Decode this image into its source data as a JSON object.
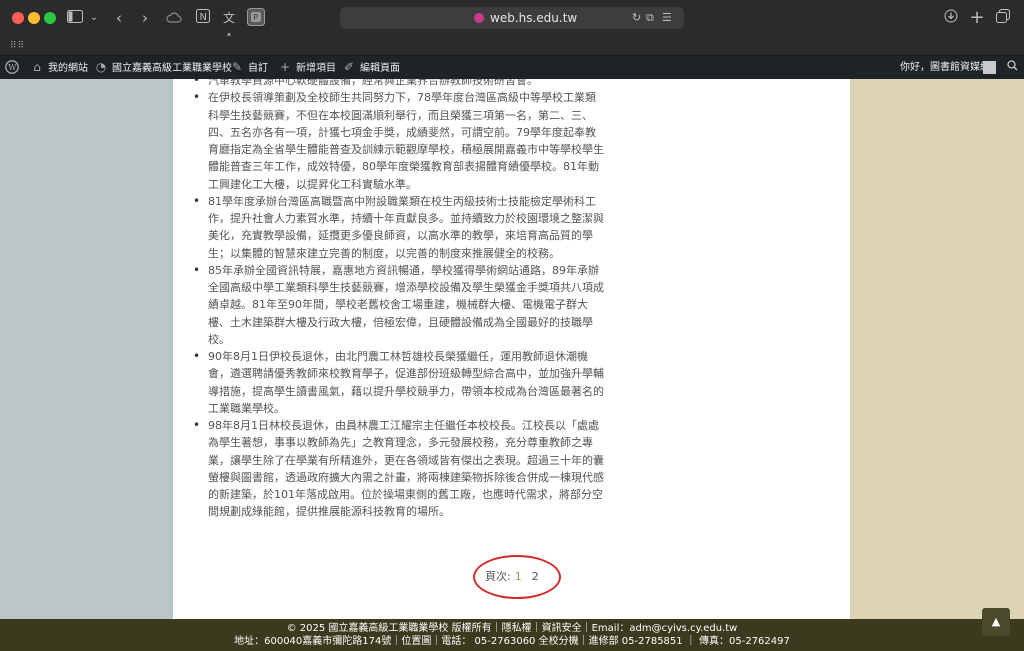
{
  "browser": {
    "url": "web.hs.edu.tw"
  },
  "adminbar": {
    "my_sites": "我的網站",
    "site_name": "國立嘉義高級工業職業學校",
    "customize": "自訂",
    "new_item": "新增項目",
    "edit_page": "編輯頁面",
    "greeting": "你好，圖書館資媒組"
  },
  "content": {
    "top_partial": "汽車教學資源中心軟硬體設備，經常與企業界合辦教師技術研習會。",
    "items": [
      "在伊校長領導策劃及全校師生共同努力下，78學年度台灣區高級中等學校工業類科學生技藝競賽，不但在本校圓滿順利舉行，而且榮獲三項第一名，第二、三、四、五名亦各有一項，計獲七項金手獎，成績斐然，可謂空前。79學年度起奉教育廳指定為全省學生體能普查及訓練示範觀摩學校，積極展開嘉義市中等學校學生體能普查三年工作，成效特優，80學年度榮獲教育部表揚體育績優學校。81年動工興建化工大樓，以提昇化工科實驗水準。",
      "81學年度承辦台灣區高職暨高中附設職業類在校生丙級技術士技能檢定學術科工作，提升社會人力素質水準，持續十年貢獻良多。並持續致力於校園環境之整潔與美化，充實教學設備，延攬更多優良師資，以高水準的教學，來培育高品質的學生；以集體的智慧來建立完善的制度，以完善的制度來推展健全的校務。",
      "85年承辦全國資訊特展，嘉惠地方資訊暢通，學校獲得學術網站通路，89年承辦全國高級中學工業類科學生技藝競賽，增添學校設備及學生榮獲金手獎項共八項成績卓越。81年至90年間，學校老舊校舍工場重建，機械群大樓、電機電子群大樓、土木建築群大樓及行政大樓，倍極宏偉，且硬體設備成為全國最好的技職學校。",
      "90年8月1日伊校長退休，由北門農工林哲雄校長榮獲繼任，運用教師退休潮機會，遴選聘請優秀教師來校教育學子，促進部份班級轉型綜合高中，並加強升學輔導措施，提高學生讀書風氣，藉以提升學校競爭力，帶領本校成為台灣區最著名的工業職業學校。",
      "98年8月1日林校長退休，由員林農工江耀宗主任繼任本校校長。江校長以「處處為學生著想，事事以教師為先」之教育理念，多元發展校務，充分尊重教師之專業，讓學生除了在學業有所精進外，更在各領域皆有傑出之表現。超過三十年的囊螢樓與圖書館，透過政府擴大內需之計畫，將兩棟建築物拆除後合併成一棟現代感的新建築，於101年落成啟用。位於操場東側的舊工廠，也應時代需求，將部分空間規劃成綠能館，提供推展能源科技教育的場所。"
    ],
    "pager_label": "頁次:",
    "pages": [
      "1",
      "2"
    ]
  },
  "footer": {
    "line1": "© 2025 國立嘉義高級工業職業學校 版權所有｜隱私權｜資訊安全｜Email：adm@cyivs.cy.edu.tw",
    "line2": "地址：600040嘉義市彌陀路174號｜位置圖｜電話： 05-2763060 全校分機｜進修部 05-2785851 ｜ 傳真：05-2762497"
  },
  "icons": {
    "wordpress": "wordpress-logo-icon",
    "customize": "brush-icon",
    "new": "plus-icon",
    "edit": "pencil-icon",
    "search": "search-icon",
    "to_top": "arrow-up-icon"
  },
  "colors": {
    "adminbar": "#1d2327",
    "footer": "#3b3a1e",
    "left_side": "#bac6c6",
    "right_side": "#dcd3b3",
    "annotation_circle": "#d12c2c"
  }
}
